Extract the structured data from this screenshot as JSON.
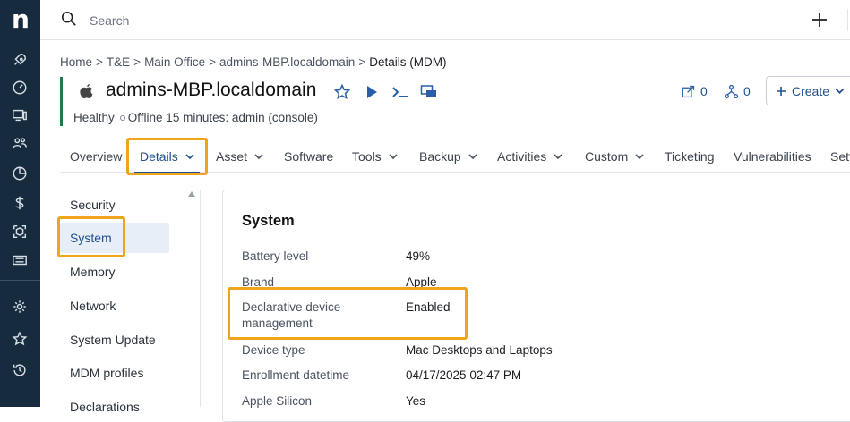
{
  "app": {
    "logo_letter": "n"
  },
  "rail": {
    "icons": [
      "rocket-icon",
      "gauge-icon",
      "devices-icon",
      "users-icon",
      "pie-chart-icon",
      "dollar-icon",
      "package-icon",
      "ticket-icon",
      "settings-icon",
      "star-icon",
      "history-icon"
    ]
  },
  "search": {
    "placeholder": "Search"
  },
  "breadcrumb": {
    "items": [
      "Home",
      "T&E",
      "Main Office",
      "admins-MBP.localdomain"
    ],
    "current": "Details (MDM)",
    "separator": ">"
  },
  "device": {
    "title": "admins-MBP.localdomain",
    "health": "Healthy",
    "status": "Offline 15 minutes: admin (console)",
    "accent_color": "#1e7a46"
  },
  "header_actions": {
    "tasks_count": "0",
    "alerts_count": "0",
    "create_label": "Create"
  },
  "tabs": [
    {
      "label": "Overview",
      "dropdown": false
    },
    {
      "label": "Details",
      "dropdown": true,
      "active": true
    },
    {
      "label": "Asset",
      "dropdown": true
    },
    {
      "label": "Software",
      "dropdown": false
    },
    {
      "label": "Tools",
      "dropdown": true
    },
    {
      "label": "Backup",
      "dropdown": true
    },
    {
      "label": "Activities",
      "dropdown": true
    },
    {
      "label": "Custom",
      "dropdown": true
    },
    {
      "label": "Ticketing",
      "dropdown": false
    },
    {
      "label": "Vulnerabilities",
      "dropdown": false
    },
    {
      "label": "Sett",
      "dropdown": false
    }
  ],
  "subnav": {
    "items": [
      "Security",
      "System",
      "Memory",
      "Network",
      "System Update",
      "MDM profiles",
      "Declarations"
    ],
    "active": "System"
  },
  "section": {
    "title": "System",
    "rows": [
      {
        "label": "Battery level",
        "value": "49%"
      },
      {
        "label": "Brand",
        "value": "Apple"
      },
      {
        "label": "Declarative device management",
        "value": "Enabled"
      },
      {
        "label": "Device type",
        "value": "Mac Desktops and Laptops"
      },
      {
        "label": "Enrollment datetime",
        "value": "04/17/2025 02:47 PM"
      },
      {
        "label": "Apple Silicon",
        "value": "Yes"
      }
    ]
  },
  "colors": {
    "rail_bg": "#162c3e",
    "link_blue": "#1e4f8f",
    "highlight": "#f0a41c"
  }
}
